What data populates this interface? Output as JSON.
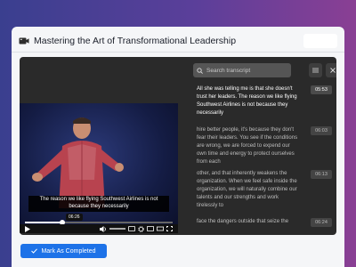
{
  "course": {
    "title": "Mastering the Art of Transformational Leadership",
    "icon": "video-camera-icon"
  },
  "video": {
    "caption": "The reason we like flying Southwest Airlines is not because they necessarily",
    "hover_time": "06:26",
    "progress": 0.25
  },
  "transcript": {
    "search_placeholder": "Search transcript",
    "segments": [
      {
        "text": "All she was telling me is that she doesn't trust her leaders. The reason we like flying Southwest Airlines is not because they necessarily",
        "time": "05:53",
        "active": true
      },
      {
        "text": "hire better people, it's because they don't fear their leaders. You see if the conditions are wrong, we are forced to expend our own time and energy to protect ourselves from each",
        "time": "06:03",
        "active": false
      },
      {
        "text": "other, and that inherently weakens the organization. When we feel safe inside the organization, we will naturally combine our talents and our strengths and work tirelessly to",
        "time": "06:13",
        "active": false
      },
      {
        "text": "face the dangers outside that seize the",
        "time": "06:24",
        "active": false
      }
    ]
  },
  "actions": {
    "mark_completed": "Mark As Completed"
  },
  "colors": {
    "primary": "#1d72e8",
    "player_bg": "#2a2a2a"
  }
}
